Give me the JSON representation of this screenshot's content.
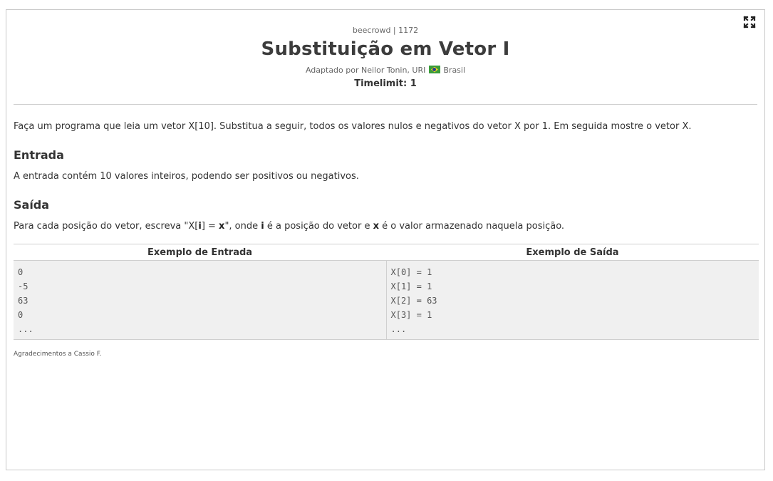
{
  "header": {
    "source": "beecrowd | 1172",
    "title": "Substituição em Vetor I",
    "author_prefix": "Adaptado por Neilor Tonin, URI",
    "author_country": "Brasil",
    "timelimit": "Timelimit: 1"
  },
  "icons": {
    "expand": "expand-arrows-icon",
    "flag": "brazil-flag-icon"
  },
  "description": "Faça um programa que leia um vetor X[10]. Substitua a seguir, todos os valores nulos e negativos do vetor X por 1. Em seguida mostre o vetor X.",
  "input_section": {
    "heading": "Entrada",
    "text": "A entrada contém 10 valores inteiros, podendo ser positivos ou negativos."
  },
  "output_section": {
    "heading": "Saída",
    "text_1": "Para cada posição do vetor, escreva \"X[",
    "bold_i": "i",
    "text_2": "] = ",
    "bold_x": "x",
    "text_3": "\", onde ",
    "bold_i2": "i",
    "text_4": " é a posição do vetor e ",
    "bold_x2": "x",
    "text_5": " é o valor armazenado naquela posição."
  },
  "examples": {
    "input_header": "Exemplo de Entrada",
    "output_header": "Exemplo de Saída",
    "input_lines": [
      "0",
      "-5",
      "63",
      "0",
      "..."
    ],
    "output_lines": [
      "X[0] = 1",
      "X[1] = 1",
      "X[2] = 63",
      "X[3] = 1",
      "..."
    ]
  },
  "acknowledgement": "Agradecimentos a Cassio F."
}
